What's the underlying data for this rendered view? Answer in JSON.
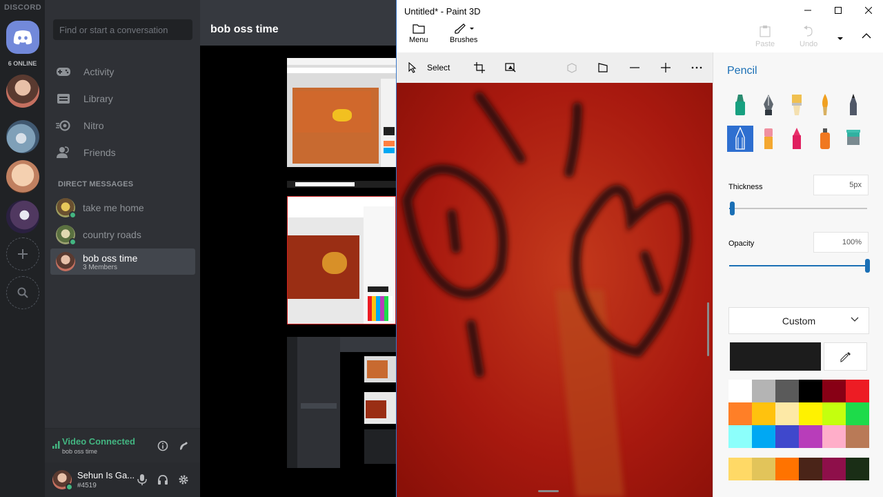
{
  "discord": {
    "wordmark": "DISCORD",
    "online_count": "6 ONLINE",
    "search_placeholder": "Find or start a conversation",
    "nav": [
      {
        "label": "Activity",
        "icon": "controller-icon"
      },
      {
        "label": "Library",
        "icon": "library-icon"
      },
      {
        "label": "Nitro",
        "icon": "nitro-icon"
      },
      {
        "label": "Friends",
        "icon": "friends-icon"
      }
    ],
    "dm_header": "DIRECT MESSAGES",
    "dms": [
      {
        "name": "take me home",
        "sub": "",
        "active": false
      },
      {
        "name": "country roads",
        "sub": "",
        "active": false
      },
      {
        "name": "bob oss time",
        "sub": "3 Members",
        "active": true
      }
    ],
    "voice": {
      "title": "Video Connected",
      "sub": "bob oss time"
    },
    "user": {
      "name": "Sehun Is Ga...",
      "tag": "#4519"
    },
    "chat_title": "bob oss time",
    "colors": {
      "blurple": "#7289da",
      "green": "#43b581"
    }
  },
  "paint3d": {
    "title": "Untitled* - Paint 3D",
    "ribbon": {
      "menu": "Menu",
      "brushes": "Brushes",
      "paste": "Paste",
      "undo": "Undo"
    },
    "toolbar": {
      "select": "Select"
    },
    "panel": {
      "title": "Pencil",
      "thickness_label": "Thickness",
      "thickness_value": "5px",
      "thickness_level": 0.02,
      "opacity_label": "Opacity",
      "opacity_value": "100%",
      "opacity_level": 1.0,
      "color_mode": "Custom",
      "current_color": "#1c1c1c",
      "palette": [
        "#ffffff",
        "#b4b4b4",
        "#5a5a5a",
        "#000000",
        "#880015",
        "#ed1c24",
        "#ff7f27",
        "#ffc20e",
        "#fde9a6",
        "#fff200",
        "#c4ff0e",
        "#1ddb4a",
        "#8cfffb",
        "#00a8f3",
        "#3f48cc",
        "#b83dba",
        "#ffaec9",
        "#b97a57"
      ],
      "palette_recent": [
        "#ffd966",
        "#e2c45a",
        "#ff7300",
        "#4a2418",
        "#8e0f4a",
        "#1a2e16"
      ],
      "accent": "#1a6fb5"
    }
  }
}
